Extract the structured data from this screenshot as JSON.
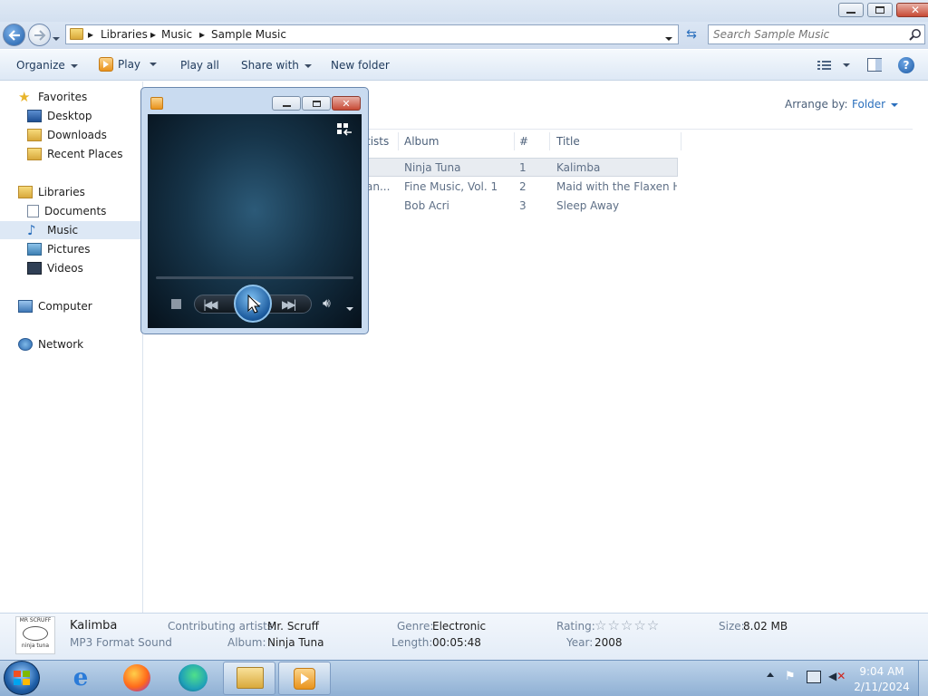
{
  "breadcrumb": [
    "Libraries",
    "Music",
    "Sample Music"
  ],
  "search": {
    "placeholder": "Search Sample Music"
  },
  "toolbar": {
    "organize": "Organize",
    "play": "Play",
    "play_all": "Play all",
    "share_with": "Share with",
    "new_folder": "New folder"
  },
  "nav": {
    "favorites": "Favorites",
    "desktop": "Desktop",
    "downloads": "Downloads",
    "recent_places": "Recent Places",
    "libraries": "Libraries",
    "documents": "Documents",
    "music": "Music",
    "pictures": "Pictures",
    "videos": "Videos",
    "computer": "Computer",
    "network": "Network"
  },
  "content": {
    "arrange_label": "Arrange by:",
    "arrange_value": "Folder",
    "columns": {
      "artists": "tists",
      "album": "Album",
      "num": "#",
      "title": "Title"
    },
    "rows": [
      {
        "artist": "",
        "album": "Ninja Tuna",
        "num": "1",
        "title": "Kalimba"
      },
      {
        "artist": "an...",
        "album": "Fine Music, Vol. 1",
        "num": "2",
        "title": "Maid with the Flaxen H..."
      },
      {
        "artist": "",
        "album": "Bob Acri",
        "num": "3",
        "title": "Sleep Away"
      }
    ]
  },
  "details": {
    "art_line1": "MR SCRUFF",
    "art_line2": "ninja tuna",
    "name": "Kalimba",
    "type": "MP3 Format Sound",
    "contributing_label": "Contributing artists:",
    "contributing_value": "Mr. Scruff",
    "album_label": "Album:",
    "album_value": "Ninja Tuna",
    "genre_label": "Genre:",
    "genre_value": "Electronic",
    "length_label": "Length:",
    "length_value": "00:05:48",
    "rating_label": "Rating:",
    "rating_stars": "☆☆☆☆☆",
    "rating_value": 0,
    "year_label": "Year:",
    "year_value": "2008",
    "size_label": "Size:",
    "size_value": "8.02 MB"
  },
  "clock": {
    "time": "9:04 AM",
    "date": "2/11/2024"
  },
  "icons": [
    "back-arrow-icon",
    "forward-arrow-icon",
    "folder-icon",
    "search-icon",
    "refresh-icon",
    "view-icon",
    "preview-pane-icon",
    "help-icon",
    "star-icon",
    "play-icon",
    "stop-icon",
    "previous-icon",
    "next-icon",
    "volume-icon",
    "switch-to-library-icon",
    "windows-start-icon",
    "internet-explorer-icon",
    "firefox-icon",
    "edge-icon",
    "flag-icon",
    "network-status-icon",
    "speaker-muted-icon"
  ],
  "colors": {
    "accent": "#2a6fbd",
    "taskbar": "#a9c3e0",
    "selection": "#dde8f5"
  }
}
